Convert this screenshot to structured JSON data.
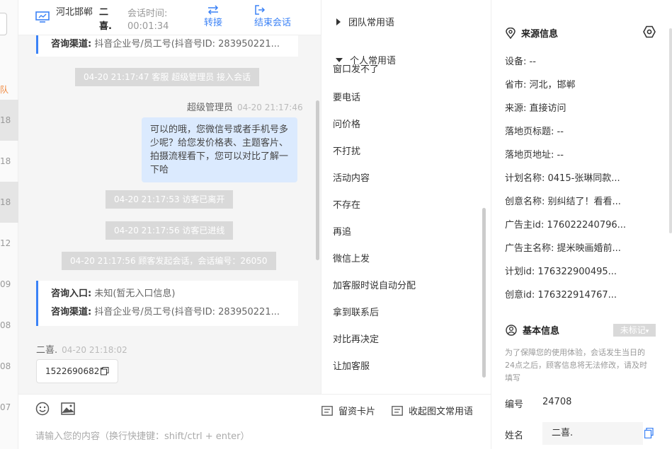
{
  "sidebar": {
    "tag": "队",
    "times": [
      "18",
      "18",
      "18",
      "12",
      "09",
      "08",
      "08",
      "07"
    ]
  },
  "header": {
    "location": "河北邯郸",
    "visitor_name": "二喜.",
    "time_label": "会话时间:",
    "time_value": "00:01:34",
    "transfer_label": "转接",
    "end_label": "结束会话"
  },
  "chat": {
    "card1": {
      "channel_label": "咨询渠道:",
      "channel_value": "抖音企业号/员工号(抖音号ID: 283950221..."
    },
    "sys1": "04-20 21:17:47 客服 超级管理员 接入会话",
    "agent_name": "超级管理员",
    "agent_time": "04-20 21:17:46",
    "agent_message": "可以的哦，您微信号或者手机号多少呢？给您发价格表、主题客片、拍摄流程看下，您可以对比了解一下哈",
    "sys2": "04-20 21:17:53 访客已离开",
    "sys3": "04-20 21:17:56 访客已进线",
    "sys4": "04-20 21:17:56 顾客发起会话，会话编号：26050",
    "card2": {
      "entry_label": "咨询入口:",
      "entry_value": "未知(暂无入口信息)",
      "channel_label": "咨询渠道:",
      "channel_value": "抖音企业号/员工号(抖音号ID: 283950221..."
    },
    "visitor_name": "二喜.",
    "visitor_time": "04-20 21:18:02",
    "visitor_message": "15226906821"
  },
  "input": {
    "emoji_icon": "smile-icon",
    "image_icon": "image-icon",
    "contact_card_label": "留资卡片",
    "collapse_label": "收起图文常用语",
    "placeholder": "请输入您的内容（换行快捷键：shift/ctrl + enter）"
  },
  "phrases": {
    "team_group": "团队常用语",
    "personal_group": "个人常用语",
    "clipped_item": "窗口发不了",
    "items": [
      "要电话",
      "问价格",
      "不打扰",
      "活动内容",
      "不存在",
      "再追",
      "微信上发",
      "加客服时说自动分配",
      "拿到联系后",
      "对比再决定",
      "让加客服"
    ]
  },
  "info": {
    "source_title": "来源信息",
    "device": "设备: --",
    "province": "省市: 河北，邯郸",
    "source": "来源: 直接访问",
    "landing_title": "落地页标题: --",
    "landing_url": "落地页地址: --",
    "plan_name": "计划名称: 0415-张琳同款...",
    "creative_name": "创意名称: 别纠结了！看看...",
    "advertiser_id": "广告主id: 176022240796...",
    "advertiser_name": "广告主名称: 提米映画婚前...",
    "plan_id": "计划id: 176322900495...",
    "creative_id": "创意id: 176322914767...",
    "basic_title": "基本信息",
    "tag_button": "未标记",
    "note": "为了保障您的使用体验，会话发生当日的24点之后，顾客信息将无法修改，请及时填写",
    "number_label": "编号",
    "number_value": "24708",
    "name_label": "姓名",
    "name_value": "二喜."
  },
  "colors": {
    "accent": "#3b82f6",
    "agent_bubble": "#dbeafe",
    "sys_bg": "#d9d9d9",
    "orange": "#f0883e"
  }
}
